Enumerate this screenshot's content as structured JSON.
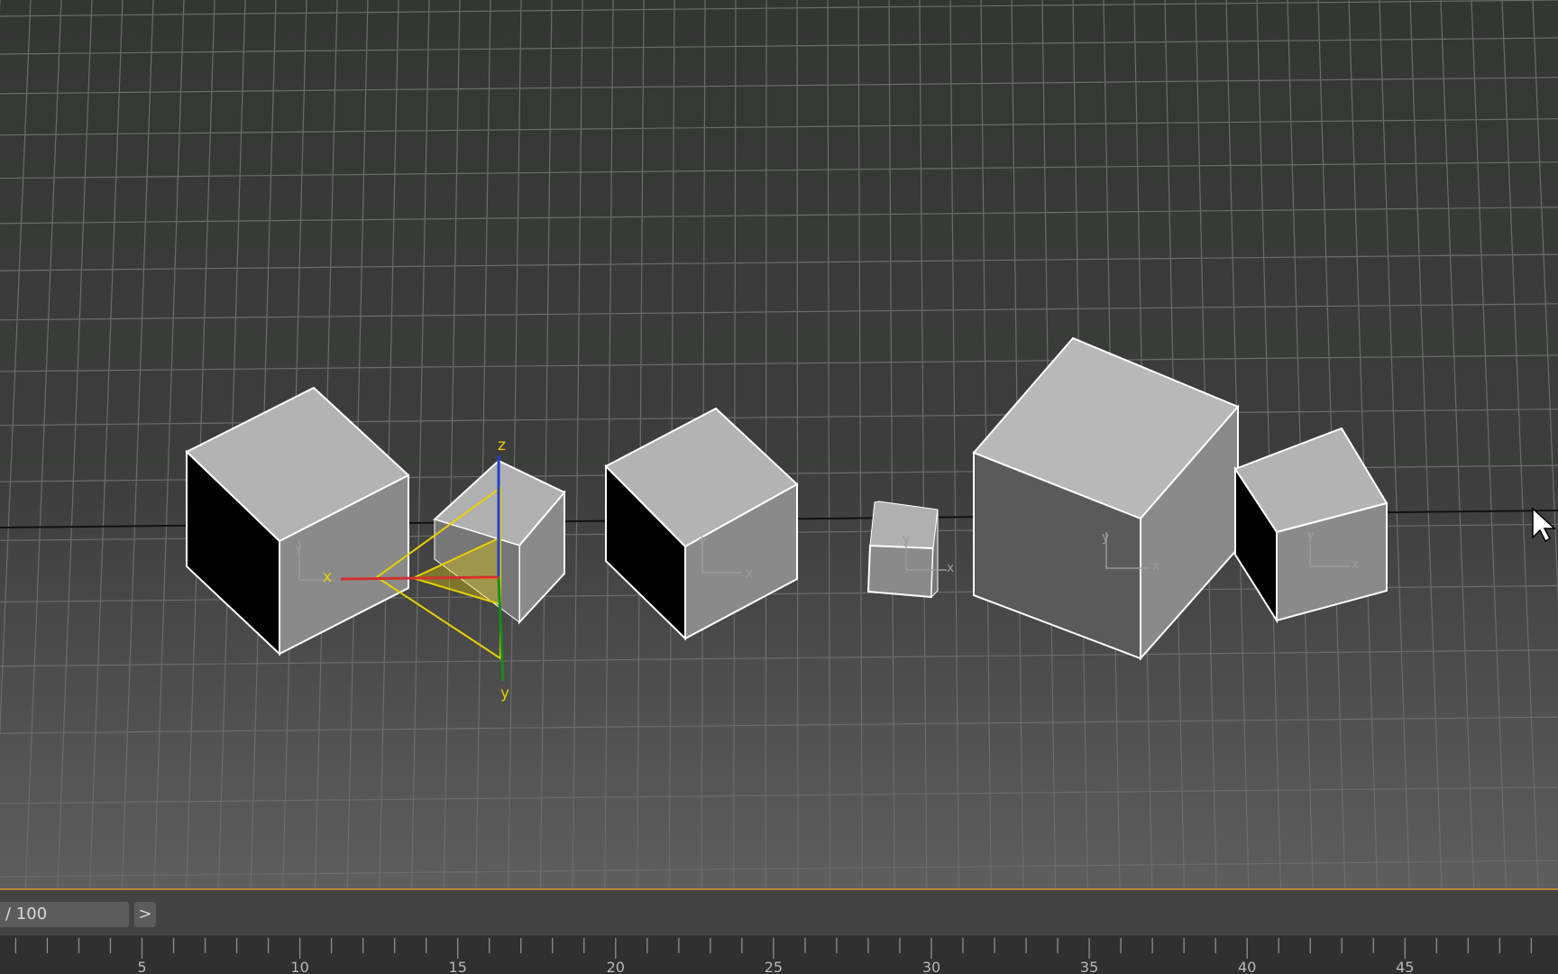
{
  "timeline": {
    "frame_text": "/ 100",
    "next_glyph": ">",
    "ruler_ticks": [
      "5",
      "10",
      "15",
      "20",
      "25",
      "30",
      "35",
      "40",
      "45"
    ]
  },
  "gizmo": {
    "z_label": "z",
    "y_label": "y",
    "x_label": "x"
  },
  "local_axes": {
    "x": "x",
    "y": "y"
  },
  "colors": {
    "background": "#3a3b3a",
    "accent_border": "#b8893a",
    "gizmo_yellow": "#e8d000",
    "gizmo_red": "#d23030",
    "gizmo_blue": "#2040d0",
    "gizmo_green": "#1a8a1a"
  }
}
